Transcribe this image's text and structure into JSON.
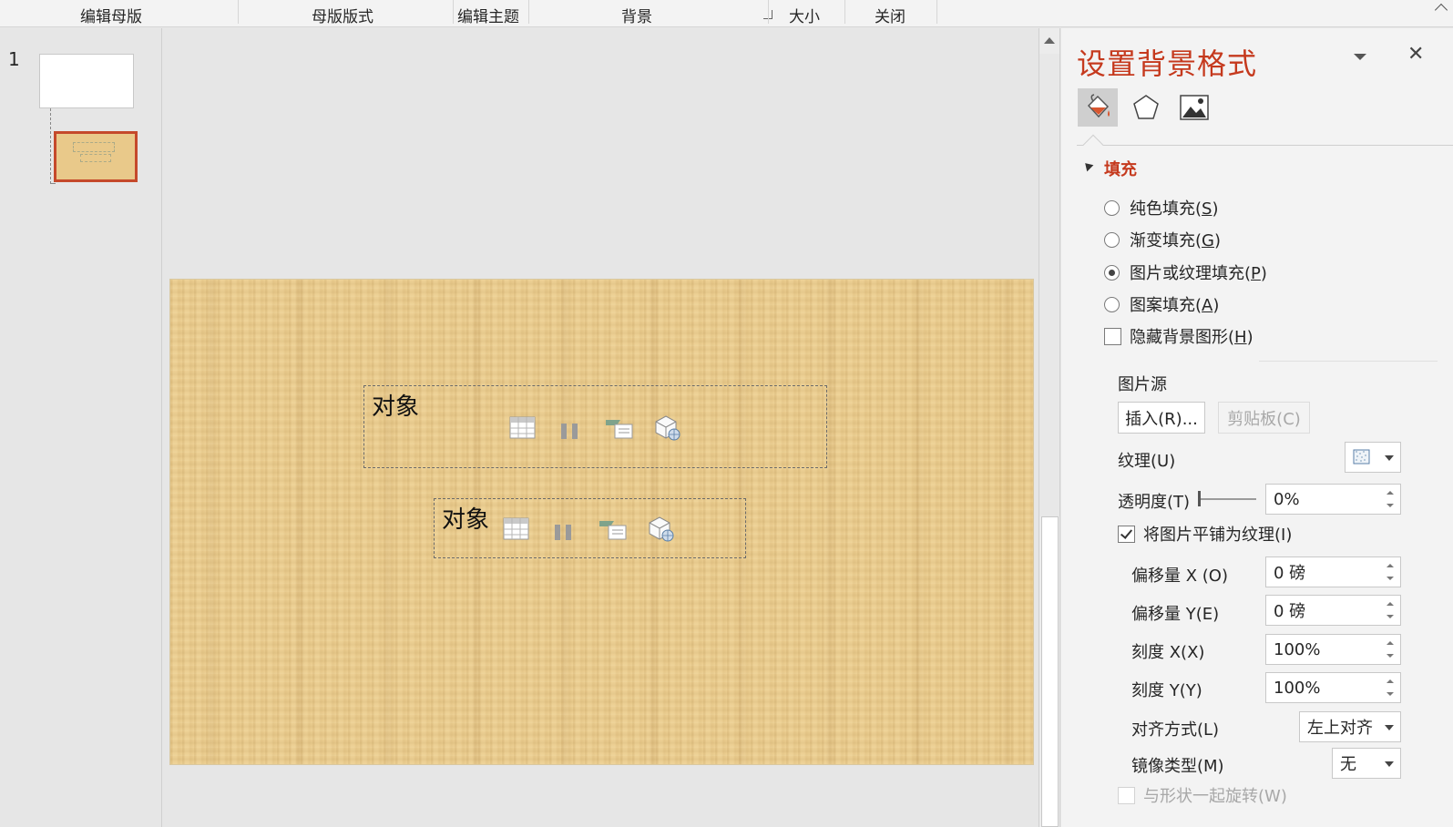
{
  "ribbon": {
    "groups": [
      "编辑母版",
      "母版版式",
      "编辑主题",
      "背景",
      "大小",
      "关闭"
    ]
  },
  "thumbnails": {
    "slide_number": "1"
  },
  "slide": {
    "placeholders": [
      {
        "label": "对象"
      },
      {
        "label": "对象"
      }
    ],
    "content_icons": [
      "table-icon",
      "chart-icon",
      "smartart-icon",
      "3d-model-icon"
    ]
  },
  "pane": {
    "title": "设置背景格式",
    "tabs": [
      "fill-bucket-icon",
      "pentagon-icon",
      "picture-icon"
    ],
    "section": "填充",
    "fill_options": [
      {
        "text": "纯色填充(",
        "key": "S",
        "tail": ")",
        "selected": false
      },
      {
        "text": "渐变填充(",
        "key": "G",
        "tail": ")",
        "selected": false
      },
      {
        "text": "图片或纹理填充(",
        "key": "P",
        "tail": ")",
        "selected": true
      },
      {
        "text": "图案填充(",
        "key": "A",
        "tail": ")",
        "selected": false
      }
    ],
    "hide_bg": {
      "text": "隐藏背景图形(",
      "key": "H",
      "tail": ")",
      "checked": false
    },
    "picture_source_label": "图片源",
    "insert_button": "插入(R)...",
    "clipboard_button": "剪贴板(C)",
    "texture_label": "纹理(U)",
    "transparency_label": "透明度(T)",
    "transparency_value": "0%",
    "transparency_fraction": 0,
    "tile_label": "将图片平铺为纹理(I)",
    "tile_checked": true,
    "offset_x_label": "偏移量 X (O)",
    "offset_x_value": "0 磅",
    "offset_y_label": "偏移量 Y(E)",
    "offset_y_value": "0 磅",
    "scale_x_label": "刻度 X(X)",
    "scale_x_value": "100%",
    "scale_y_label": "刻度 Y(Y)",
    "scale_y_value": "100%",
    "align_label": "对齐方式(L)",
    "align_value": "左上对齐",
    "mirror_label": "镜像类型(M)",
    "mirror_value": "无",
    "rotate_label": "与形状一起旋转(W)",
    "rotate_checked": false,
    "accent": "#c5391d"
  }
}
